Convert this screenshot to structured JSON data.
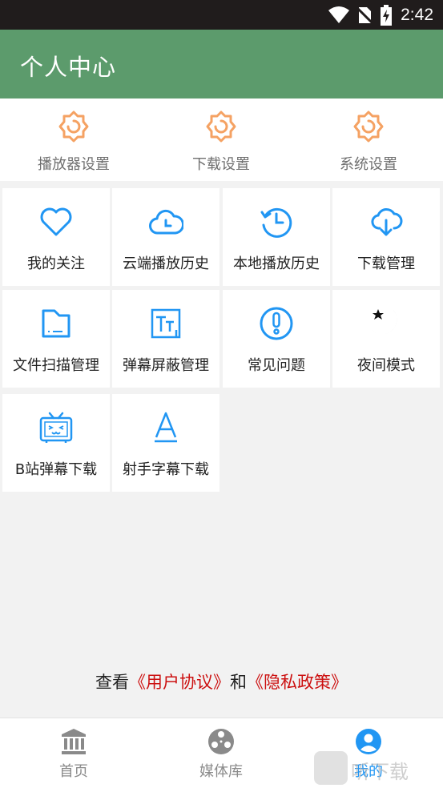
{
  "status_bar": {
    "time": "2:42"
  },
  "header": {
    "title": "个人中心"
  },
  "settings": [
    {
      "label": "播放器设置",
      "icon": "gear-icon"
    },
    {
      "label": "下载设置",
      "icon": "gear-icon"
    },
    {
      "label": "系统设置",
      "icon": "gear-icon"
    }
  ],
  "grid": [
    {
      "label": "我的关注",
      "icon": "heart-icon"
    },
    {
      "label": "云端播放历史",
      "icon": "cloud-clock-icon"
    },
    {
      "label": "本地播放历史",
      "icon": "history-clock-icon"
    },
    {
      "label": "下载管理",
      "icon": "cloud-download-icon"
    },
    {
      "label": "文件扫描管理",
      "icon": "folder-icon"
    },
    {
      "label": "弹幕屏蔽管理",
      "icon": "text-box-icon"
    },
    {
      "label": "常见问题",
      "icon": "exclamation-icon"
    },
    {
      "label": "夜间模式",
      "icon": "moon-icon"
    },
    {
      "label": "B站弹幕下载",
      "icon": "tv-icon"
    },
    {
      "label": "射手字幕下载",
      "icon": "letter-a-icon"
    }
  ],
  "agreement": {
    "prefix": "查看",
    "user_agreement": "《用户协议》",
    "and": "和",
    "privacy_policy": "《隐私政策》"
  },
  "bottom_nav": [
    {
      "label": "首页",
      "icon": "bank-icon"
    },
    {
      "label": "媒体库",
      "icon": "film-reel-icon"
    },
    {
      "label": "我的",
      "icon": "user-circle-icon",
      "active": true
    }
  ],
  "watermark": {
    "text": "听下载"
  },
  "colors": {
    "header_bg": "#5c9b6c",
    "accent_orange": "#f5a263",
    "accent_blue": "#2196f3",
    "link_red": "#cc1010"
  }
}
